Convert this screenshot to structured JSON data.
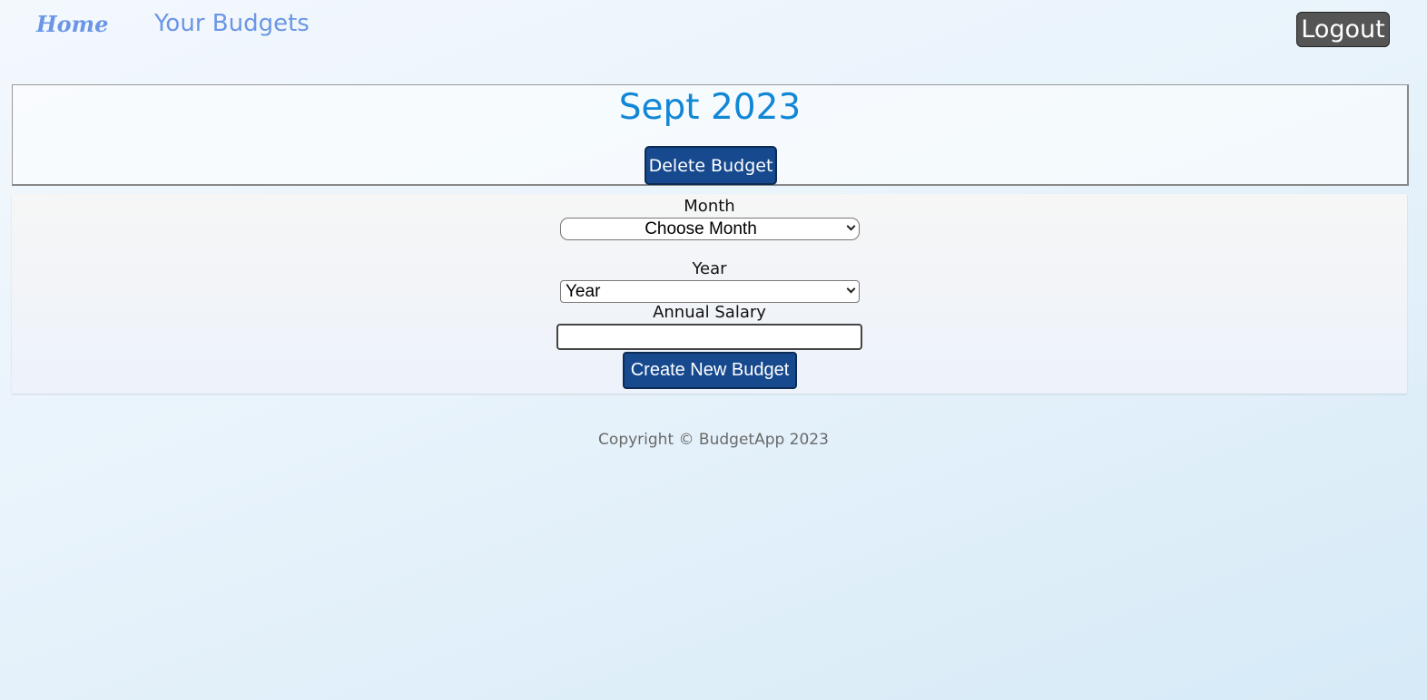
{
  "nav": {
    "home_label": "Home",
    "budgets_label": "Your Budgets",
    "logout_label": "Logout"
  },
  "budget": {
    "title": "Sept 2023",
    "delete_label": "Delete Budget"
  },
  "form": {
    "month_label": "Month",
    "month_selected": "Choose Month",
    "year_label": "Year",
    "year_selected": "Year",
    "salary_label": "Annual Salary",
    "salary_value": "",
    "create_label": "Create New Budget"
  },
  "footer": {
    "copyright": "Copyright © BudgetApp 2023"
  },
  "colors": {
    "nav_link": "#6b96e6",
    "title": "#1187d6",
    "primary_button": "#17498e",
    "logout_button": "#555555"
  }
}
